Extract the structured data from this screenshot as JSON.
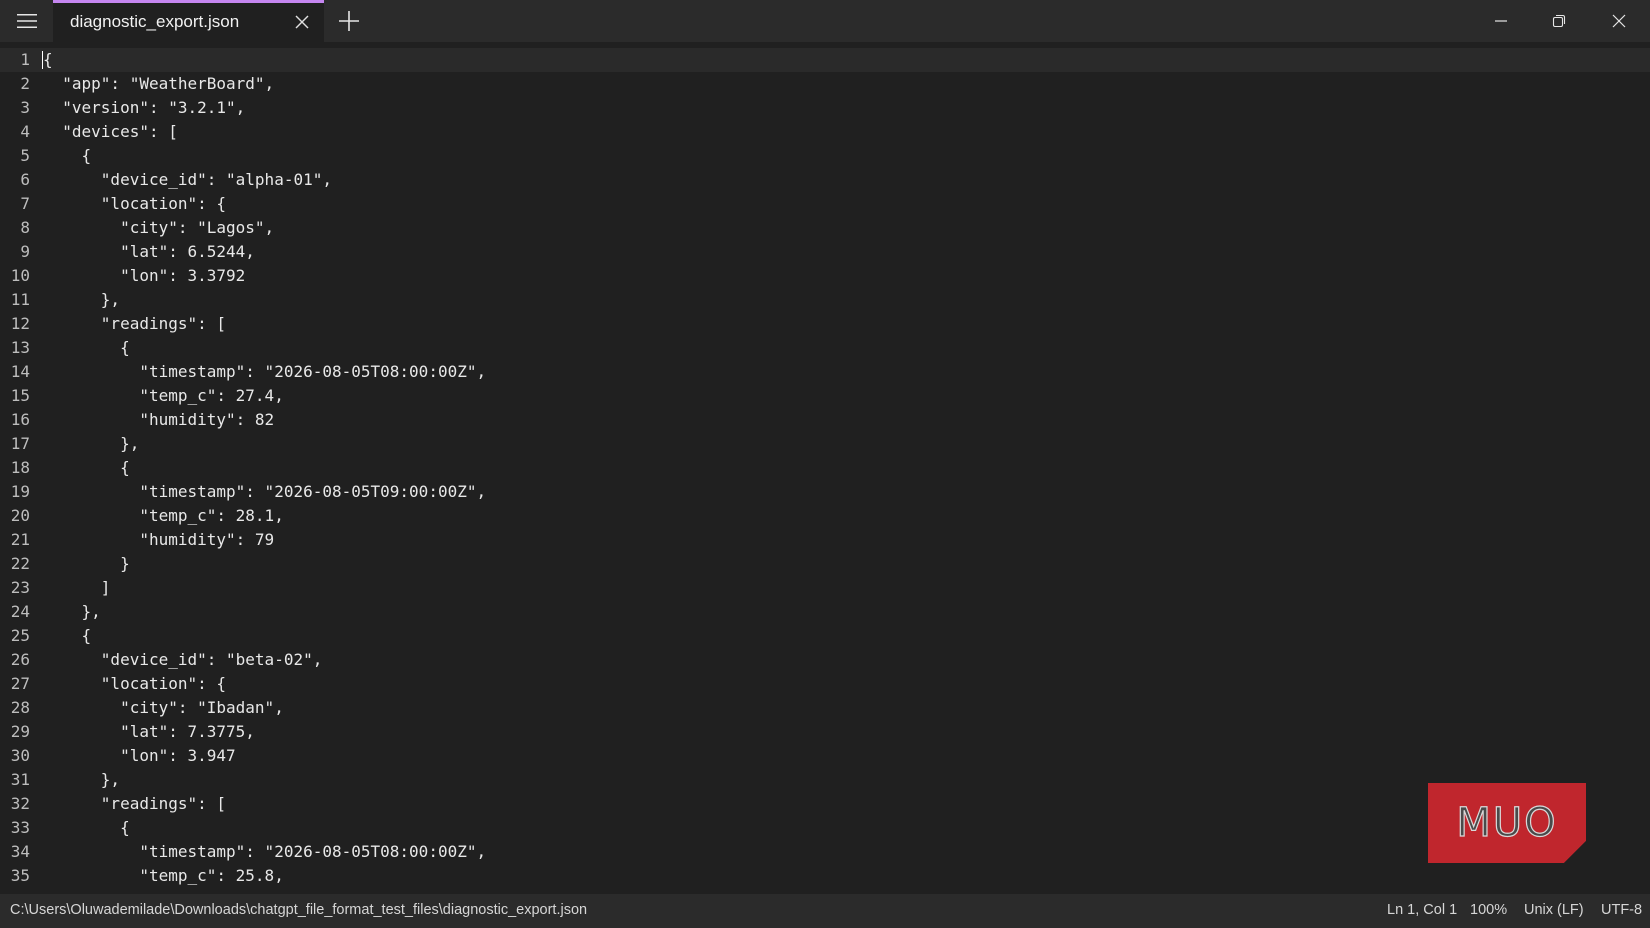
{
  "titlebar": {
    "tab_label": "diagnostic_export.json",
    "icons": {
      "menu": "hamburger-menu-icon",
      "tab_close": "close-icon",
      "new_tab": "plus-icon",
      "minimize": "minimize-icon",
      "maximize": "restore-icon",
      "close": "close-icon"
    }
  },
  "editor": {
    "lines": [
      {
        "n": "1",
        "text": "{"
      },
      {
        "n": "2",
        "text": "  \"app\": \"WeatherBoard\","
      },
      {
        "n": "3",
        "text": "  \"version\": \"3.2.1\","
      },
      {
        "n": "4",
        "text": "  \"devices\": ["
      },
      {
        "n": "5",
        "text": "    {"
      },
      {
        "n": "6",
        "text": "      \"device_id\": \"alpha-01\","
      },
      {
        "n": "7",
        "text": "      \"location\": {"
      },
      {
        "n": "8",
        "text": "        \"city\": \"Lagos\","
      },
      {
        "n": "9",
        "text": "        \"lat\": 6.5244,"
      },
      {
        "n": "10",
        "text": "        \"lon\": 3.3792"
      },
      {
        "n": "11",
        "text": "      },"
      },
      {
        "n": "12",
        "text": "      \"readings\": ["
      },
      {
        "n": "13",
        "text": "        {"
      },
      {
        "n": "14",
        "text": "          \"timestamp\": \"2026-08-05T08:00:00Z\","
      },
      {
        "n": "15",
        "text": "          \"temp_c\": 27.4,"
      },
      {
        "n": "16",
        "text": "          \"humidity\": 82"
      },
      {
        "n": "17",
        "text": "        },"
      },
      {
        "n": "18",
        "text": "        {"
      },
      {
        "n": "19",
        "text": "          \"timestamp\": \"2026-08-05T09:00:00Z\","
      },
      {
        "n": "20",
        "text": "          \"temp_c\": 28.1,"
      },
      {
        "n": "21",
        "text": "          \"humidity\": 79"
      },
      {
        "n": "22",
        "text": "        }"
      },
      {
        "n": "23",
        "text": "      ]"
      },
      {
        "n": "24",
        "text": "    },"
      },
      {
        "n": "25",
        "text": "    {"
      },
      {
        "n": "26",
        "text": "      \"device_id\": \"beta-02\","
      },
      {
        "n": "27",
        "text": "      \"location\": {"
      },
      {
        "n": "28",
        "text": "        \"city\": \"Ibadan\","
      },
      {
        "n": "29",
        "text": "        \"lat\": 7.3775,"
      },
      {
        "n": "30",
        "text": "        \"lon\": 3.947"
      },
      {
        "n": "31",
        "text": "      },"
      },
      {
        "n": "32",
        "text": "      \"readings\": ["
      },
      {
        "n": "33",
        "text": "        {"
      },
      {
        "n": "34",
        "text": "          \"timestamp\": \"2026-08-05T08:00:00Z\","
      },
      {
        "n": "35",
        "text": "          \"temp_c\": 25.8,"
      }
    ]
  },
  "watermark": {
    "text": "MUO",
    "color": "#c0262d"
  },
  "statusbar": {
    "path": "C:\\Users\\Oluwademilade\\Downloads\\chatgpt_file_format_test_files\\diagnostic_export.json",
    "position": "Ln 1, Col 1",
    "zoom": "100%",
    "line_ending": "Unix (LF)",
    "encoding": "UTF-8"
  },
  "colors": {
    "background": "#202020",
    "chrome": "#2b2b2b",
    "tab_accent": "#c586f0",
    "text": "#e8e8e8"
  }
}
